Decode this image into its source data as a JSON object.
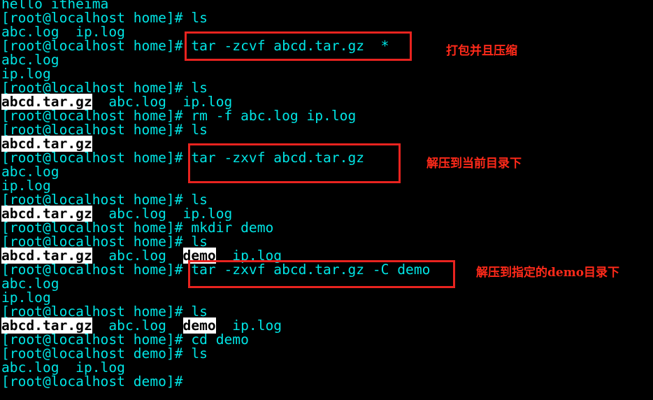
{
  "terminal": {
    "lines": [
      {
        "parts": [
          {
            "text": "hello itheima"
          }
        ]
      },
      {
        "parts": [
          {
            "text": "[root@localhost home]# ls"
          }
        ]
      },
      {
        "parts": [
          {
            "text": "abc.log  ip.log"
          }
        ]
      },
      {
        "parts": [
          {
            "text": "[root@localhost home]# tar -zcvf abcd.tar.gz  *"
          }
        ]
      },
      {
        "parts": [
          {
            "text": "abc.log"
          }
        ]
      },
      {
        "parts": [
          {
            "text": "ip.log"
          }
        ]
      },
      {
        "parts": [
          {
            "text": "[root@localhost home]# ls"
          }
        ]
      },
      {
        "parts": [
          {
            "text": "abcd.tar.gz",
            "highlight": true
          },
          {
            "text": "  abc.log  ip.log"
          }
        ]
      },
      {
        "parts": [
          {
            "text": "[root@localhost home]# rm -f abc.log ip.log"
          }
        ]
      },
      {
        "parts": [
          {
            "text": "[root@localhost home]# ls"
          }
        ]
      },
      {
        "parts": [
          {
            "text": "abcd.tar.gz",
            "highlight": true
          }
        ]
      },
      {
        "parts": [
          {
            "text": "[root@localhost home]# tar -zxvf abcd.tar.gz"
          }
        ]
      },
      {
        "parts": [
          {
            "text": "abc.log"
          }
        ]
      },
      {
        "parts": [
          {
            "text": "ip.log"
          }
        ]
      },
      {
        "parts": [
          {
            "text": "[root@localhost home]# ls"
          }
        ]
      },
      {
        "parts": [
          {
            "text": "abcd.tar.gz",
            "highlight": true
          },
          {
            "text": "  abc.log  ip.log"
          }
        ]
      },
      {
        "parts": [
          {
            "text": "[root@localhost home]# mkdir demo"
          }
        ]
      },
      {
        "parts": [
          {
            "text": "[root@localhost home]# ls"
          }
        ]
      },
      {
        "parts": [
          {
            "text": "abcd.tar.gz",
            "highlight": true
          },
          {
            "text": "  abc.log  "
          },
          {
            "text": "demo",
            "highlight": true
          },
          {
            "text": "  ip.log"
          }
        ]
      },
      {
        "parts": [
          {
            "text": "[root@localhost home]# tar -zxvf abcd.tar.gz -C demo"
          }
        ]
      },
      {
        "parts": [
          {
            "text": "abc.log"
          }
        ]
      },
      {
        "parts": [
          {
            "text": "ip.log"
          }
        ]
      },
      {
        "parts": [
          {
            "text": "[root@localhost home]# ls"
          }
        ]
      },
      {
        "parts": [
          {
            "text": "abcd.tar.gz",
            "highlight": true
          },
          {
            "text": "  abc.log  "
          },
          {
            "text": "demo",
            "highlight": true
          },
          {
            "text": "  ip.log"
          }
        ]
      },
      {
        "parts": [
          {
            "text": "[root@localhost home]# cd demo"
          }
        ]
      },
      {
        "parts": [
          {
            "text": "[root@localhost demo]# ls"
          }
        ]
      },
      {
        "parts": [
          {
            "text": "abc.log  ip.log"
          }
        ]
      },
      {
        "parts": [
          {
            "text": "[root@localhost demo]#"
          }
        ]
      }
    ]
  },
  "annotations": {
    "note1": "打包并且压缩",
    "note2": "解压到当前目录下",
    "note3": "解压到指定的demo目录下"
  },
  "colors": {
    "background": "#000000",
    "text": "#00e5e5",
    "highlight_bg": "#ffffff",
    "highlight_text": "#000000",
    "annotation": "#ff2a1a"
  }
}
